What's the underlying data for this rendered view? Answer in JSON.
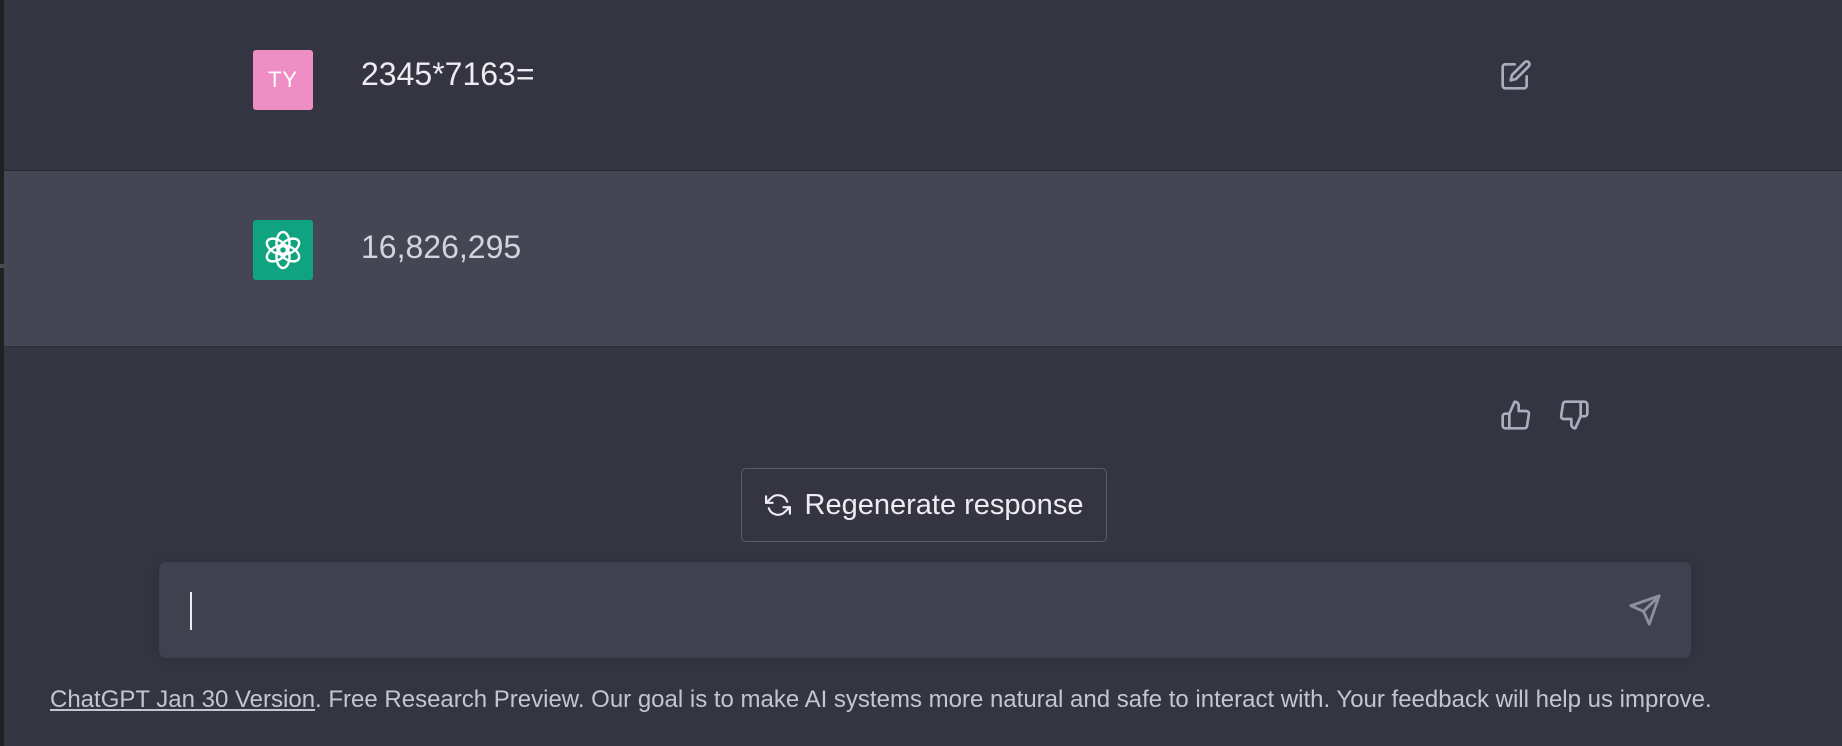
{
  "conversation": {
    "user_message": {
      "avatar_initials": "TY",
      "text": "2345*7163="
    },
    "assistant_message": {
      "avatar_icon": "openai-logo-icon",
      "text": "16,826,295"
    }
  },
  "actions": {
    "edit_icon": "edit-icon",
    "thumbs_up_icon": "thumbs-up-icon",
    "thumbs_down_icon": "thumbs-down-icon",
    "regenerate_label": "Regenerate response",
    "regenerate_icon": "refresh-icon"
  },
  "composer": {
    "value": "",
    "send_icon": "send-icon"
  },
  "footer": {
    "version_link": "ChatGPT Jan 30 Version",
    "text": ". Free Research Preview. Our goal is to make AI systems more natural and safe to interact with. Your feedback will help us improve."
  },
  "colors": {
    "background": "#343541",
    "assistant_row": "#444654",
    "user_avatar": "#ef8ec4",
    "assistant_avatar": "#10a37f",
    "input_bg": "#40414f"
  }
}
